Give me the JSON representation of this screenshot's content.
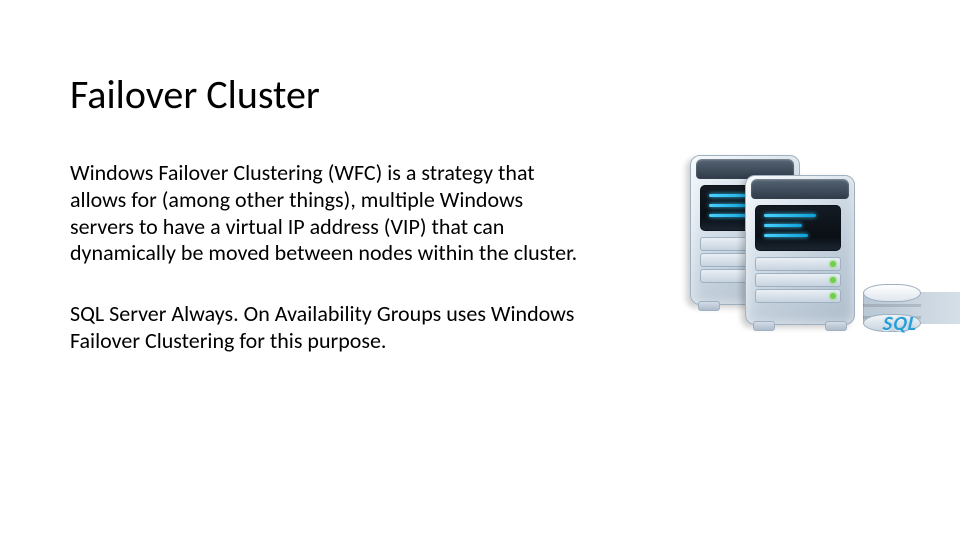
{
  "title": "Failover Cluster",
  "paragraphs": {
    "p1": "Windows Failover Clustering (WFC) is a strategy that allows for (among other things), multiple Windows servers to have a virtual IP address (VIP) that can dynamically be moved between nodes within the cluster.",
    "p2": "SQL Server Always. On Availability Groups uses Windows Failover Clustering for this purpose."
  },
  "illustration": {
    "sql_label": "SQL"
  }
}
